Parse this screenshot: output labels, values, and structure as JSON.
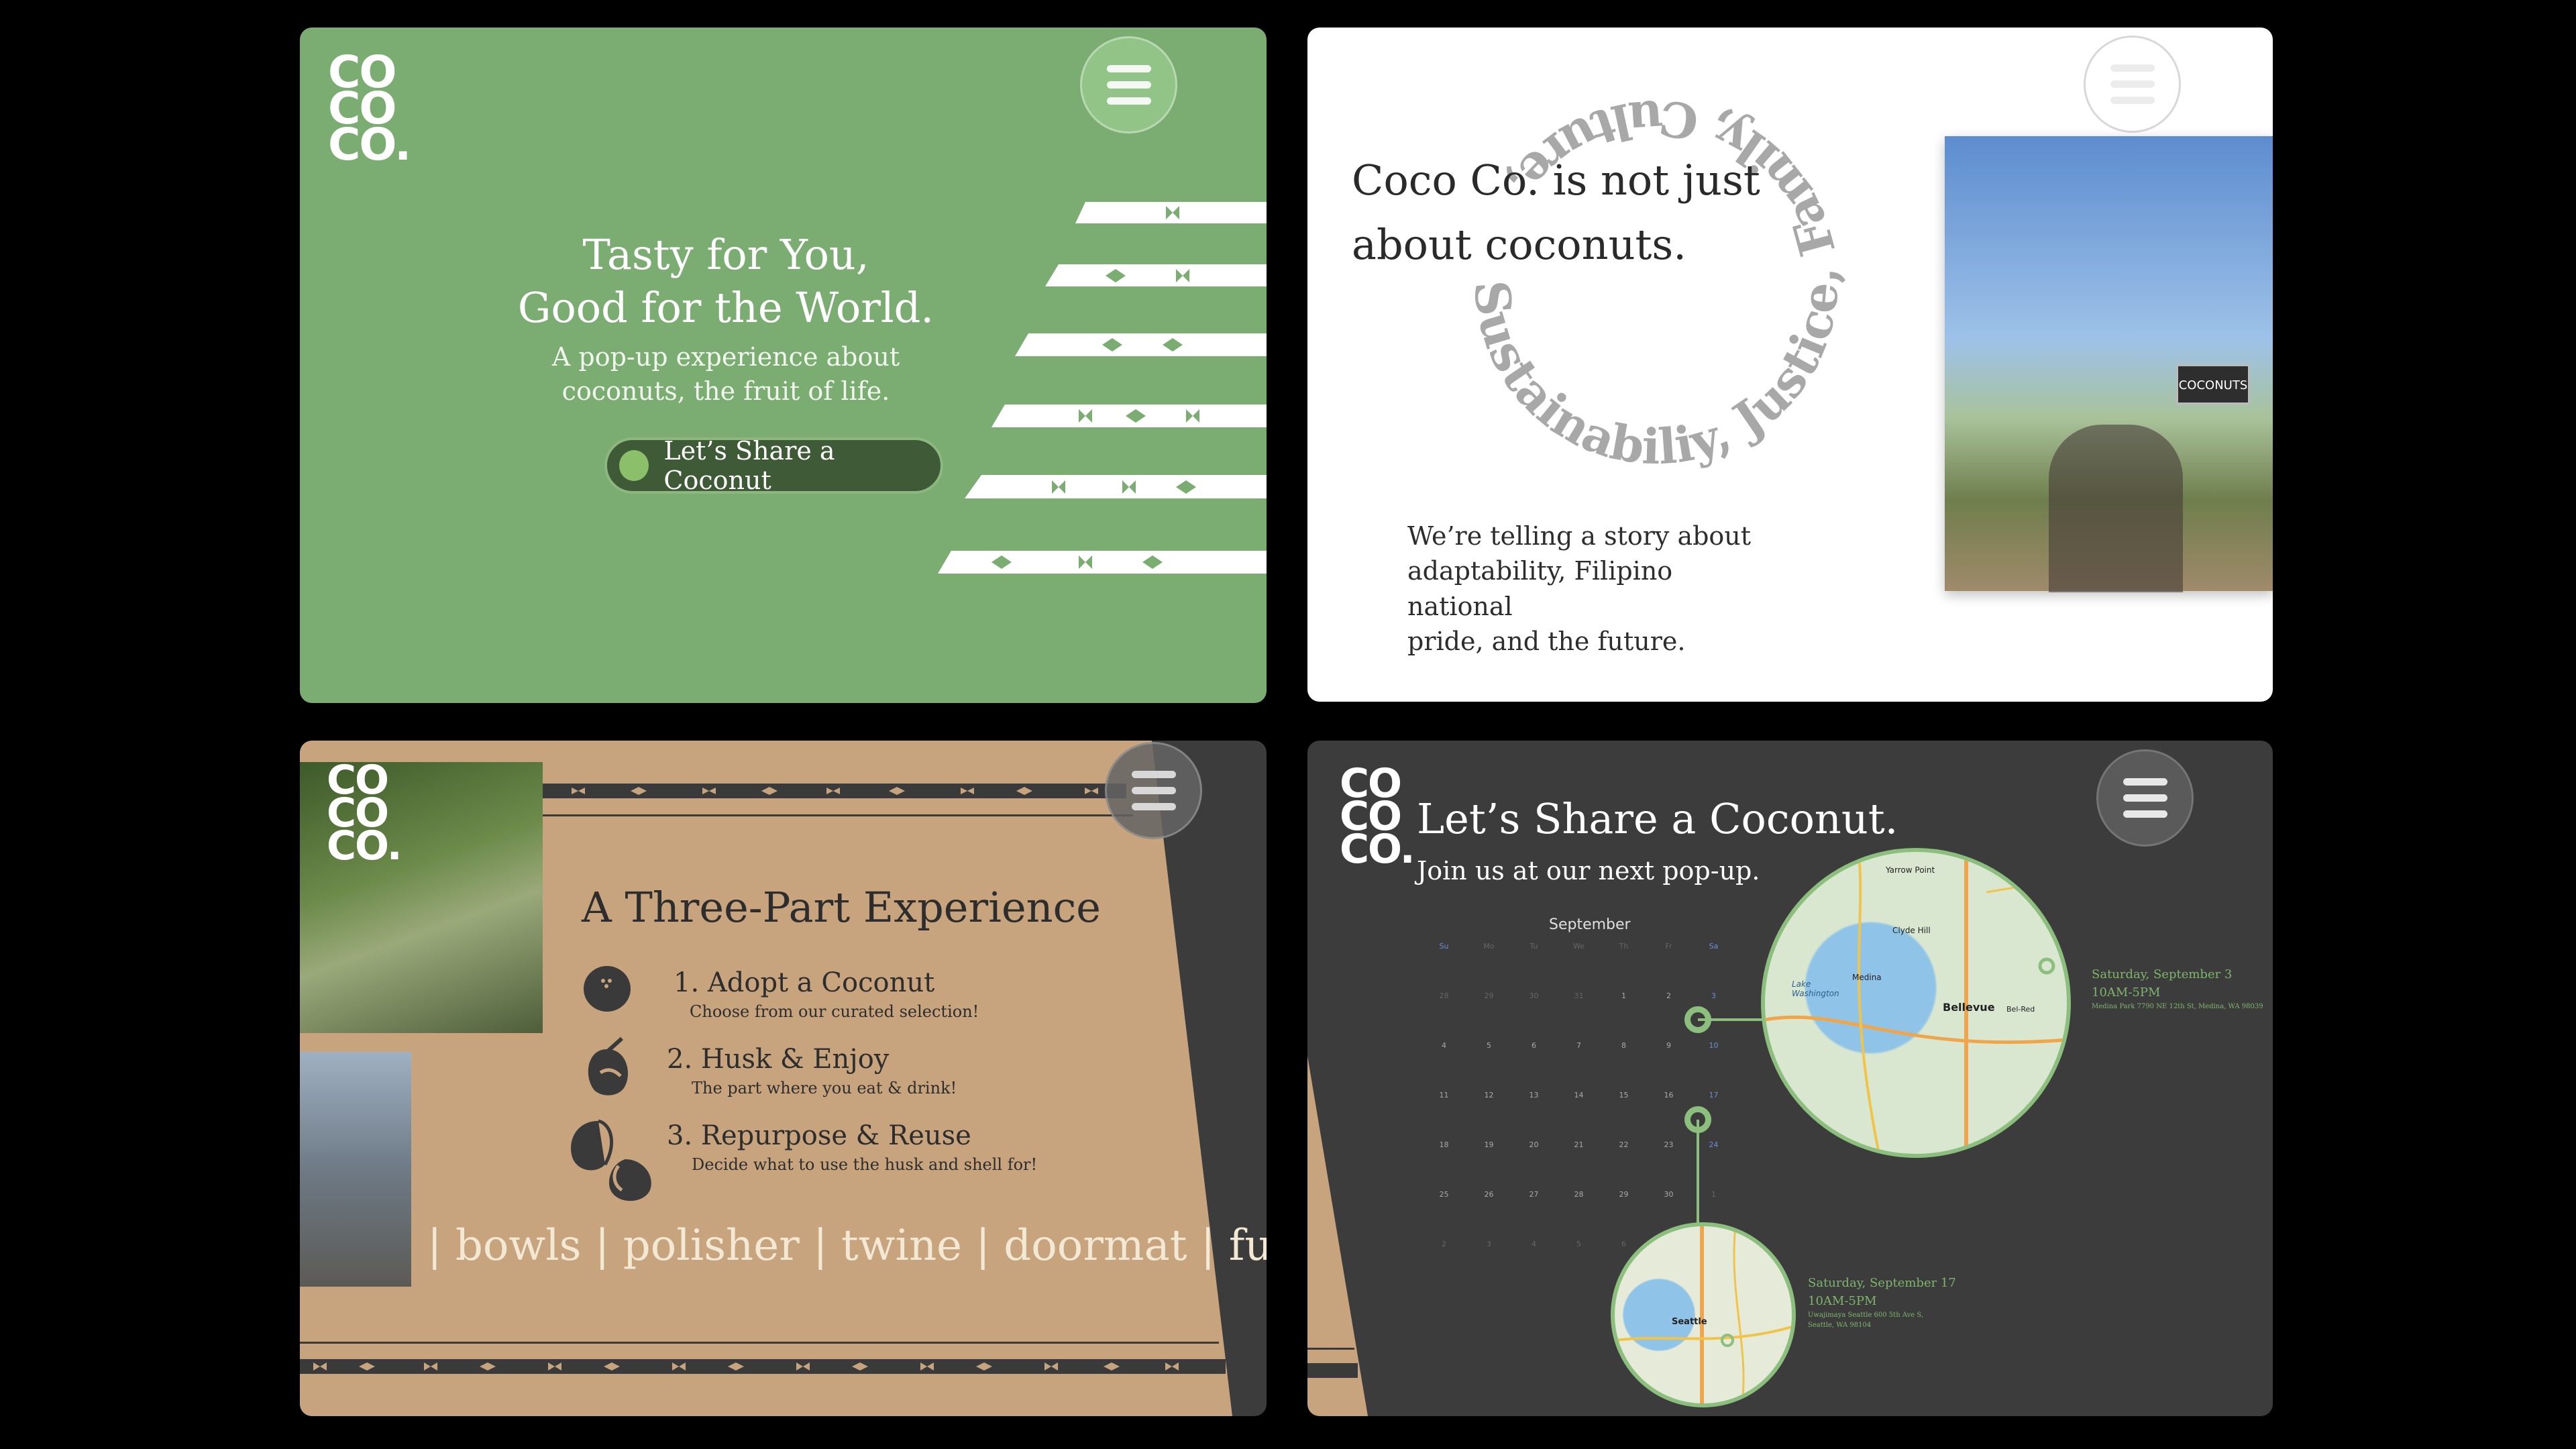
{
  "colors": {
    "green": "#7bad72",
    "tan": "#c8a47e",
    "charcoal": "#3c3c3c",
    "white": "#ffffff",
    "accent_green": "#8cbf7e"
  },
  "logo": {
    "line1": "CO",
    "line2": "CO",
    "line3": "CO."
  },
  "panel1": {
    "menu_icon": "hamburger-icon",
    "title_line1": "Tasty for You,",
    "title_line2": "Good for the World.",
    "subtitle_line1": "A pop-up experience about",
    "subtitle_line2": "coconuts, the fruit of life.",
    "cta_label": "Let’s Share a Coconut"
  },
  "panel2": {
    "menu_icon": "hamburger-icon",
    "title_line1": "Coco Co. is not just",
    "title_line2": "about coconuts.",
    "ring_text": "Sustainabiliy, Justice, Family, Culture, ",
    "body_line1": "We’re telling a story about",
    "body_line2": "adaptability, Filipino national",
    "body_line3": "pride, and the future.",
    "photo_sign": "COCONUTS"
  },
  "panel3": {
    "menu_icon": "hamburger-icon",
    "title": "A Three-Part Experience",
    "steps": [
      {
        "heading": "1. Adopt a Coconut",
        "desc": "Choose from our curated selection!",
        "icon": "coconut-icon"
      },
      {
        "heading": "2. Husk & Enjoy",
        "desc": "The part where you eat & drink!",
        "icon": "husked-coconut-icon"
      },
      {
        "heading": "3. Repurpose & Reuse",
        "desc": "Decide what to use the husk and shell for!",
        "icon": "coconut-halves-icon"
      }
    ],
    "ticker": "| bowls | polisher | twine | doormat | fuel |"
  },
  "panel4": {
    "menu_icon": "hamburger-icon",
    "title": "Let’s Share a Coconut.",
    "subtitle": "Join us at our next pop-up.",
    "calendar": {
      "month": "September",
      "weekdays": [
        "Su",
        "Mo",
        "Tu",
        "We",
        "Th",
        "Fr",
        "Sa"
      ],
      "weeks": [
        [
          "28",
          "29",
          "30",
          "31",
          "1",
          "2",
          "3"
        ],
        [
          "4",
          "5",
          "6",
          "7",
          "8",
          "9",
          "10"
        ],
        [
          "11",
          "12",
          "13",
          "14",
          "15",
          "16",
          "17"
        ],
        [
          "18",
          "19",
          "20",
          "21",
          "22",
          "23",
          "24"
        ],
        [
          "25",
          "26",
          "27",
          "28",
          "29",
          "30",
          "1"
        ],
        [
          "2",
          "3",
          "4",
          "5",
          "6",
          "7",
          "8"
        ]
      ]
    },
    "map1_labels": {
      "a": "Yarrow Point",
      "b": "Clyde Hill",
      "c": "Medina",
      "d": "Lake Washington",
      "e": "Bellevue",
      "f": "Bel-Red"
    },
    "map2_labels": {
      "a": "Seattle"
    },
    "events": [
      {
        "date": "Saturday, September 3",
        "time": "10AM-5PM",
        "address": "Medina Park 7790 NE 12th St, Medina, WA 98039"
      },
      {
        "date": "Saturday, September 17",
        "time": "10AM-5PM",
        "address_line1": "Uwajimaya Seattle 600 5th Ave S,",
        "address_line2": "Seattle, WA 98104"
      }
    ]
  }
}
